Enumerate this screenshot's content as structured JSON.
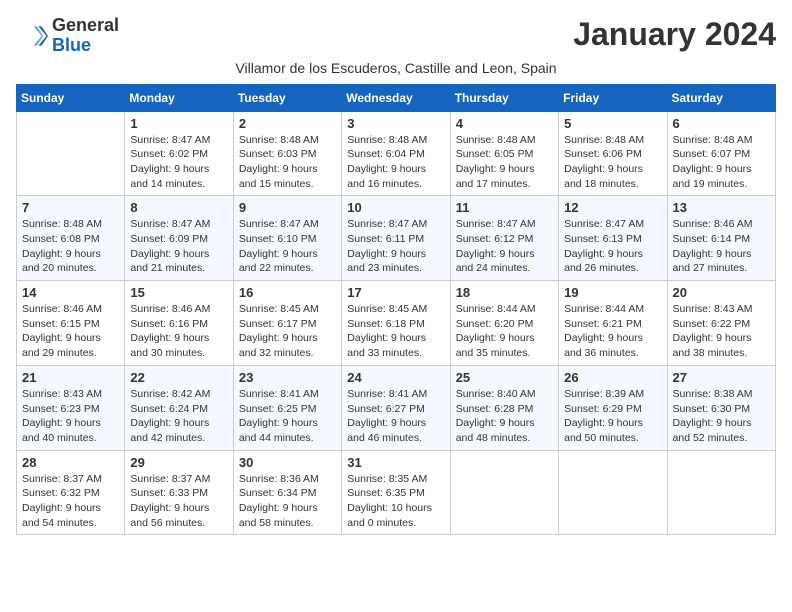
{
  "header": {
    "logo_general": "General",
    "logo_blue": "Blue",
    "month_title": "January 2024",
    "location": "Villamor de los Escuderos, Castille and Leon, Spain"
  },
  "days_of_week": [
    "Sunday",
    "Monday",
    "Tuesday",
    "Wednesday",
    "Thursday",
    "Friday",
    "Saturday"
  ],
  "weeks": [
    [
      {
        "day": "",
        "info": ""
      },
      {
        "day": "1",
        "info": "Sunrise: 8:47 AM\nSunset: 6:02 PM\nDaylight: 9 hours\nand 14 minutes."
      },
      {
        "day": "2",
        "info": "Sunrise: 8:48 AM\nSunset: 6:03 PM\nDaylight: 9 hours\nand 15 minutes."
      },
      {
        "day": "3",
        "info": "Sunrise: 8:48 AM\nSunset: 6:04 PM\nDaylight: 9 hours\nand 16 minutes."
      },
      {
        "day": "4",
        "info": "Sunrise: 8:48 AM\nSunset: 6:05 PM\nDaylight: 9 hours\nand 17 minutes."
      },
      {
        "day": "5",
        "info": "Sunrise: 8:48 AM\nSunset: 6:06 PM\nDaylight: 9 hours\nand 18 minutes."
      },
      {
        "day": "6",
        "info": "Sunrise: 8:48 AM\nSunset: 6:07 PM\nDaylight: 9 hours\nand 19 minutes."
      }
    ],
    [
      {
        "day": "7",
        "info": "Sunrise: 8:48 AM\nSunset: 6:08 PM\nDaylight: 9 hours\nand 20 minutes."
      },
      {
        "day": "8",
        "info": "Sunrise: 8:47 AM\nSunset: 6:09 PM\nDaylight: 9 hours\nand 21 minutes."
      },
      {
        "day": "9",
        "info": "Sunrise: 8:47 AM\nSunset: 6:10 PM\nDaylight: 9 hours\nand 22 minutes."
      },
      {
        "day": "10",
        "info": "Sunrise: 8:47 AM\nSunset: 6:11 PM\nDaylight: 9 hours\nand 23 minutes."
      },
      {
        "day": "11",
        "info": "Sunrise: 8:47 AM\nSunset: 6:12 PM\nDaylight: 9 hours\nand 24 minutes."
      },
      {
        "day": "12",
        "info": "Sunrise: 8:47 AM\nSunset: 6:13 PM\nDaylight: 9 hours\nand 26 minutes."
      },
      {
        "day": "13",
        "info": "Sunrise: 8:46 AM\nSunset: 6:14 PM\nDaylight: 9 hours\nand 27 minutes."
      }
    ],
    [
      {
        "day": "14",
        "info": "Sunrise: 8:46 AM\nSunset: 6:15 PM\nDaylight: 9 hours\nand 29 minutes."
      },
      {
        "day": "15",
        "info": "Sunrise: 8:46 AM\nSunset: 6:16 PM\nDaylight: 9 hours\nand 30 minutes."
      },
      {
        "day": "16",
        "info": "Sunrise: 8:45 AM\nSunset: 6:17 PM\nDaylight: 9 hours\nand 32 minutes."
      },
      {
        "day": "17",
        "info": "Sunrise: 8:45 AM\nSunset: 6:18 PM\nDaylight: 9 hours\nand 33 minutes."
      },
      {
        "day": "18",
        "info": "Sunrise: 8:44 AM\nSunset: 6:20 PM\nDaylight: 9 hours\nand 35 minutes."
      },
      {
        "day": "19",
        "info": "Sunrise: 8:44 AM\nSunset: 6:21 PM\nDaylight: 9 hours\nand 36 minutes."
      },
      {
        "day": "20",
        "info": "Sunrise: 8:43 AM\nSunset: 6:22 PM\nDaylight: 9 hours\nand 38 minutes."
      }
    ],
    [
      {
        "day": "21",
        "info": "Sunrise: 8:43 AM\nSunset: 6:23 PM\nDaylight: 9 hours\nand 40 minutes."
      },
      {
        "day": "22",
        "info": "Sunrise: 8:42 AM\nSunset: 6:24 PM\nDaylight: 9 hours\nand 42 minutes."
      },
      {
        "day": "23",
        "info": "Sunrise: 8:41 AM\nSunset: 6:25 PM\nDaylight: 9 hours\nand 44 minutes."
      },
      {
        "day": "24",
        "info": "Sunrise: 8:41 AM\nSunset: 6:27 PM\nDaylight: 9 hours\nand 46 minutes."
      },
      {
        "day": "25",
        "info": "Sunrise: 8:40 AM\nSunset: 6:28 PM\nDaylight: 9 hours\nand 48 minutes."
      },
      {
        "day": "26",
        "info": "Sunrise: 8:39 AM\nSunset: 6:29 PM\nDaylight: 9 hours\nand 50 minutes."
      },
      {
        "day": "27",
        "info": "Sunrise: 8:38 AM\nSunset: 6:30 PM\nDaylight: 9 hours\nand 52 minutes."
      }
    ],
    [
      {
        "day": "28",
        "info": "Sunrise: 8:37 AM\nSunset: 6:32 PM\nDaylight: 9 hours\nand 54 minutes."
      },
      {
        "day": "29",
        "info": "Sunrise: 8:37 AM\nSunset: 6:33 PM\nDaylight: 9 hours\nand 56 minutes."
      },
      {
        "day": "30",
        "info": "Sunrise: 8:36 AM\nSunset: 6:34 PM\nDaylight: 9 hours\nand 58 minutes."
      },
      {
        "day": "31",
        "info": "Sunrise: 8:35 AM\nSunset: 6:35 PM\nDaylight: 10 hours\nand 0 minutes."
      },
      {
        "day": "",
        "info": ""
      },
      {
        "day": "",
        "info": ""
      },
      {
        "day": "",
        "info": ""
      }
    ]
  ]
}
